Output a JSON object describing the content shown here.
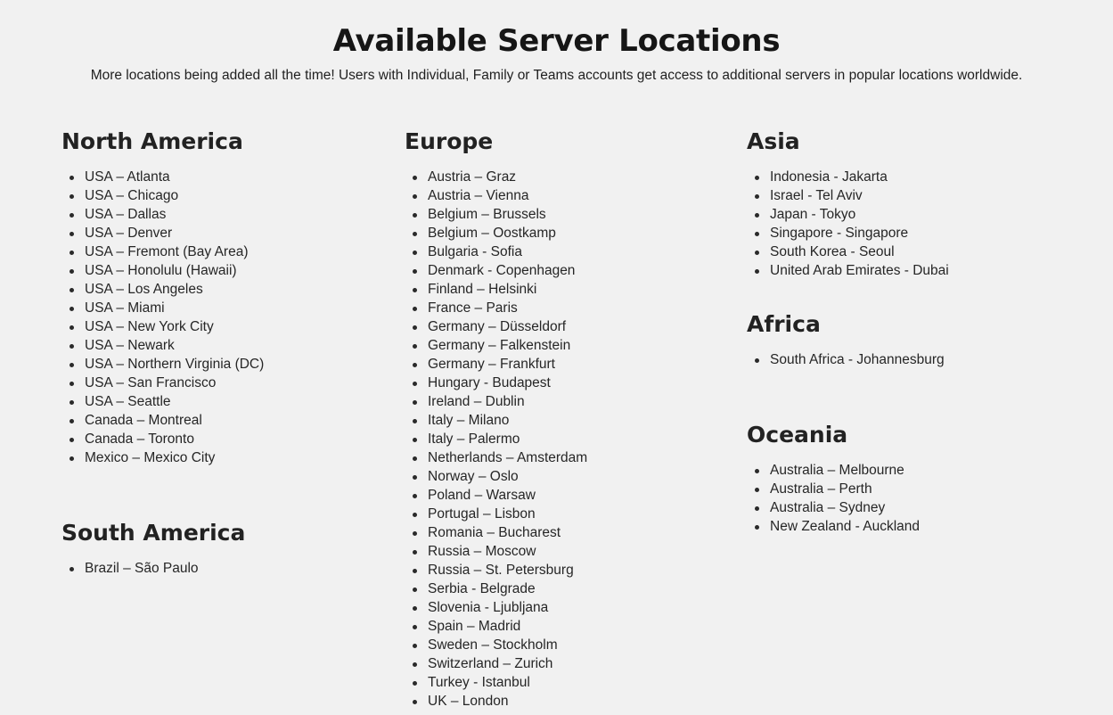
{
  "header": {
    "title": "Available Server Locations",
    "subtitle": "More locations being added all the time! Users with Individual, Family or Teams accounts get access to additional servers in popular locations worldwide."
  },
  "regions": {
    "north_america": {
      "title": "North America",
      "locations": [
        "USA – Atlanta",
        "USA – Chicago",
        "USA – Dallas",
        "USA – Denver",
        "USA – Fremont (Bay Area)",
        "USA – Honolulu (Hawaii)",
        "USA – Los Angeles",
        "USA – Miami",
        "USA – New York City",
        "USA – Newark",
        "USA – Northern Virginia (DC)",
        "USA – San Francisco",
        "USA – Seattle",
        "Canada – Montreal",
        "Canada – Toronto",
        "Mexico – Mexico City"
      ]
    },
    "south_america": {
      "title": "South America",
      "locations": [
        "Brazil – São Paulo"
      ]
    },
    "europe": {
      "title": "Europe",
      "locations": [
        "Austria – Graz",
        "Austria – Vienna",
        "Belgium – Brussels",
        "Belgium – Oostkamp",
        "Bulgaria - Sofia",
        "Denmark - Copenhagen",
        "Finland – Helsinki",
        "France – Paris",
        "Germany – Düsseldorf",
        "Germany – Falkenstein",
        "Germany – Frankfurt",
        "Hungary - Budapest",
        "Ireland – Dublin",
        "Italy – Milano",
        "Italy – Palermo",
        "Netherlands – Amsterdam",
        "Norway – Oslo",
        "Poland – Warsaw",
        "Portugal – Lisbon",
        "Romania – Bucharest",
        "Russia – Moscow",
        "Russia – St. Petersburg",
        "Serbia - Belgrade",
        "Slovenia - Ljubljana",
        "Spain – Madrid",
        "Sweden – Stockholm",
        "Switzerland – Zurich",
        "Turkey - Istanbul",
        "UK – London"
      ]
    },
    "asia": {
      "title": "Asia",
      "locations": [
        "Indonesia - Jakarta",
        "Israel - Tel Aviv",
        "Japan - Tokyo",
        "Singapore - Singapore",
        "South Korea - Seoul",
        "United Arab Emirates - Dubai"
      ]
    },
    "africa": {
      "title": "Africa",
      "locations": [
        "South Africa - Johannesburg"
      ]
    },
    "oceania": {
      "title": "Oceania",
      "locations": [
        "Australia – Melbourne",
        "Australia – Perth",
        "Australia – Sydney",
        "New Zealand - Auckland"
      ]
    }
  }
}
